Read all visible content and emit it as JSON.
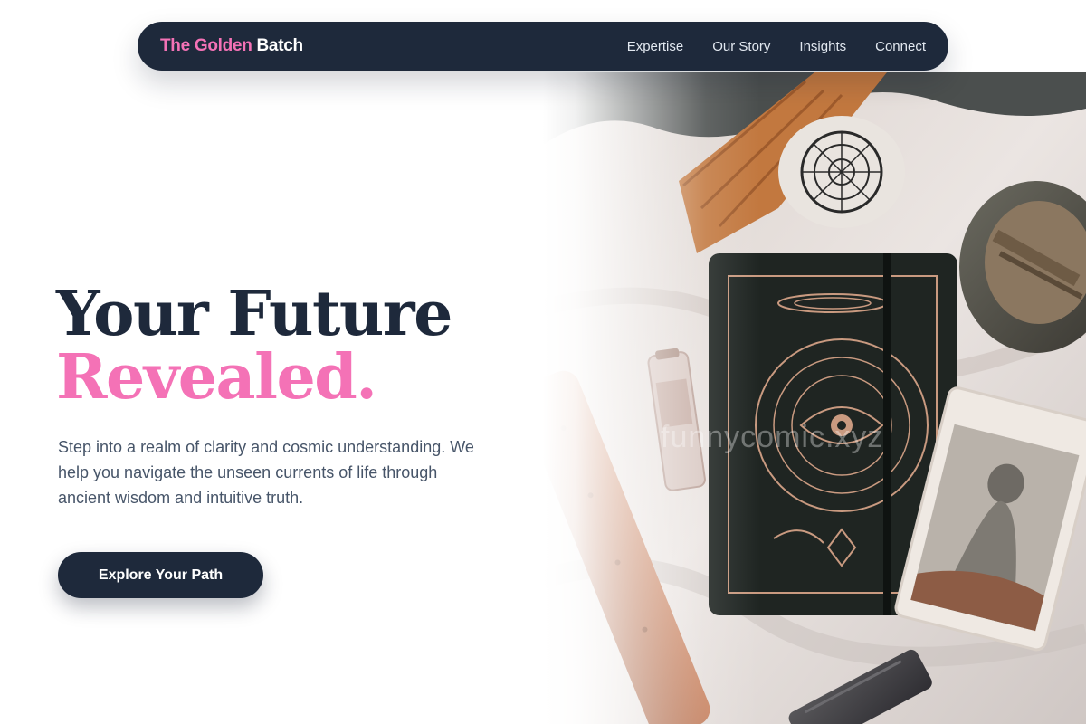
{
  "brand": {
    "accent": "The Golden",
    "rest": "Batch"
  },
  "nav": {
    "items": [
      "Expertise",
      "Our Story",
      "Insights",
      "Connect"
    ]
  },
  "hero": {
    "title_line1": "Your Future",
    "title_line2": "Revealed.",
    "subtitle": "Step into a realm of clarity and cosmic understanding. We help you navigate the unseen currents of life through ancient wisdom and intuitive truth.",
    "cta_label": "Explore Your Path",
    "image_watermark": "funnycomic.xyz"
  },
  "colors": {
    "navy": "#1e293b",
    "pink": "#f472b6",
    "text_muted": "#475569",
    "white": "#ffffff"
  }
}
